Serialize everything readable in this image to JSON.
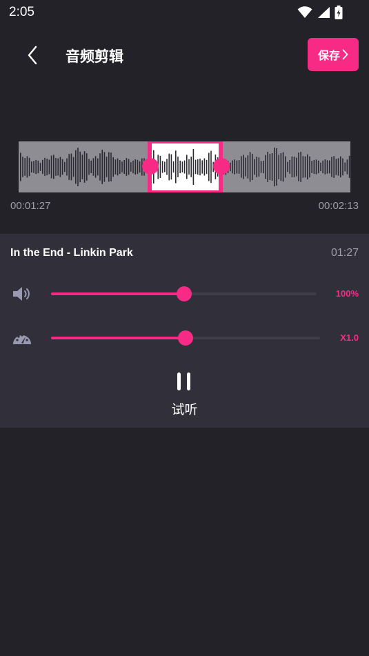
{
  "status": {
    "time": "2:05"
  },
  "header": {
    "title": "音频剪辑",
    "save_label": "保存"
  },
  "waveform": {
    "start_time": "00:01:27",
    "end_time": "00:02:13"
  },
  "track": {
    "name": "In the End - Linkin Park",
    "duration": "01:27"
  },
  "volume": {
    "value_label": "100%",
    "level": 0.5
  },
  "speed": {
    "value_label": "X1.0",
    "level": 0.5
  },
  "playback": {
    "label": "试听"
  },
  "colors": {
    "accent": "#f72b86",
    "background": "#232229",
    "panel": "#302f3a"
  },
  "icons": [
    "back-chevron-icon",
    "chevron-right-icon",
    "speaker-icon",
    "speedometer-icon",
    "pause-icon",
    "wifi-icon",
    "signal-icon",
    "battery-icon"
  ]
}
